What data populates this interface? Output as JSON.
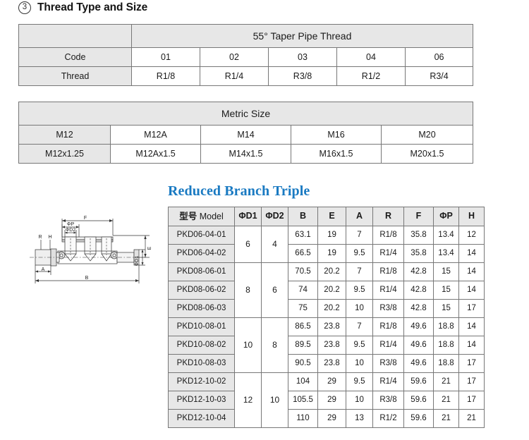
{
  "section": {
    "number": "3",
    "title": "Thread Type and Size"
  },
  "thread_table": {
    "title": "55°  Taper Pipe Thread",
    "rows": [
      {
        "label": "Code",
        "values": [
          "01",
          "02",
          "03",
          "04",
          "06"
        ]
      },
      {
        "label": "Thread",
        "values": [
          "R1/8",
          "R1/4",
          "R3/8",
          "R1/2",
          "R3/4"
        ]
      }
    ]
  },
  "metric_table": {
    "title": "Metric Size",
    "codes": [
      "M12",
      "M12A",
      "M14",
      "M16",
      "M20"
    ],
    "sizes": [
      "M12x1.25",
      "M12Ax1.5",
      "M14x1.5",
      "M16x1.5",
      "M20x1.5"
    ]
  },
  "product": {
    "title": "Reduced Branch Triple"
  },
  "drawing": {
    "labels": {
      "f": "F",
      "phi_p": "ΦP",
      "phi_d2": "ΦD2",
      "r": "R",
      "h": "H",
      "a": "A",
      "b": "B",
      "e": "E",
      "phi_d1": "ΦD1"
    }
  },
  "spec_table": {
    "headers": {
      "model_cjk": "型号",
      "model_en": "Model",
      "cols": [
        "ΦD1",
        "ΦD2",
        "B",
        "E",
        "A",
        "R",
        "F",
        "ΦP",
        "H"
      ]
    },
    "groups": [
      {
        "d1": "6",
        "d2": "4",
        "rows": [
          {
            "model": "PKD06-04-01",
            "B": "63.1",
            "E": "19",
            "A": "7",
            "R": "R1/8",
            "F": "35.8",
            "P": "13.4",
            "H": "12"
          },
          {
            "model": "PKD06-04-02",
            "B": "66.5",
            "E": "19",
            "A": "9.5",
            "R": "R1/4",
            "F": "35.8",
            "P": "13.4",
            "H": "14"
          }
        ]
      },
      {
        "d1": "8",
        "d2": "6",
        "rows": [
          {
            "model": "PKD08-06-01",
            "B": "70.5",
            "E": "20.2",
            "A": "7",
            "R": "R1/8",
            "F": "42.8",
            "P": "15",
            "H": "14"
          },
          {
            "model": "PKD08-06-02",
            "B": "74",
            "E": "20.2",
            "A": "9.5",
            "R": "R1/4",
            "F": "42.8",
            "P": "15",
            "H": "14"
          },
          {
            "model": "PKD08-06-03",
            "B": "75",
            "E": "20.2",
            "A": "10",
            "R": "R3/8",
            "F": "42.8",
            "P": "15",
            "H": "17"
          }
        ]
      },
      {
        "d1": "10",
        "d2": "8",
        "rows": [
          {
            "model": "PKD10-08-01",
            "B": "86.5",
            "E": "23.8",
            "A": "7",
            "R": "R1/8",
            "F": "49.6",
            "P": "18.8",
            "H": "14"
          },
          {
            "model": "PKD10-08-02",
            "B": "89.5",
            "E": "23.8",
            "A": "9.5",
            "R": "R1/4",
            "F": "49.6",
            "P": "18.8",
            "H": "14"
          },
          {
            "model": "PKD10-08-03",
            "B": "90.5",
            "E": "23.8",
            "A": "10",
            "R": "R3/8",
            "F": "49.6",
            "P": "18.8",
            "H": "17"
          }
        ]
      },
      {
        "d1": "12",
        "d2": "10",
        "rows": [
          {
            "model": "PKD12-10-02",
            "B": "104",
            "E": "29",
            "A": "9.5",
            "R": "R1/4",
            "F": "59.6",
            "P": "21",
            "H": "17"
          },
          {
            "model": "PKD12-10-03",
            "B": "105.5",
            "E": "29",
            "A": "10",
            "R": "R3/8",
            "F": "59.6",
            "P": "21",
            "H": "17"
          },
          {
            "model": "PKD12-10-04",
            "B": "110",
            "E": "29",
            "A": "13",
            "R": "R1/2",
            "F": "59.6",
            "P": "21",
            "H": "21"
          }
        ]
      }
    ]
  },
  "colors": {
    "accent": "#1a7ac2",
    "header_fill": "#e7e7e7",
    "border": "#777777"
  }
}
